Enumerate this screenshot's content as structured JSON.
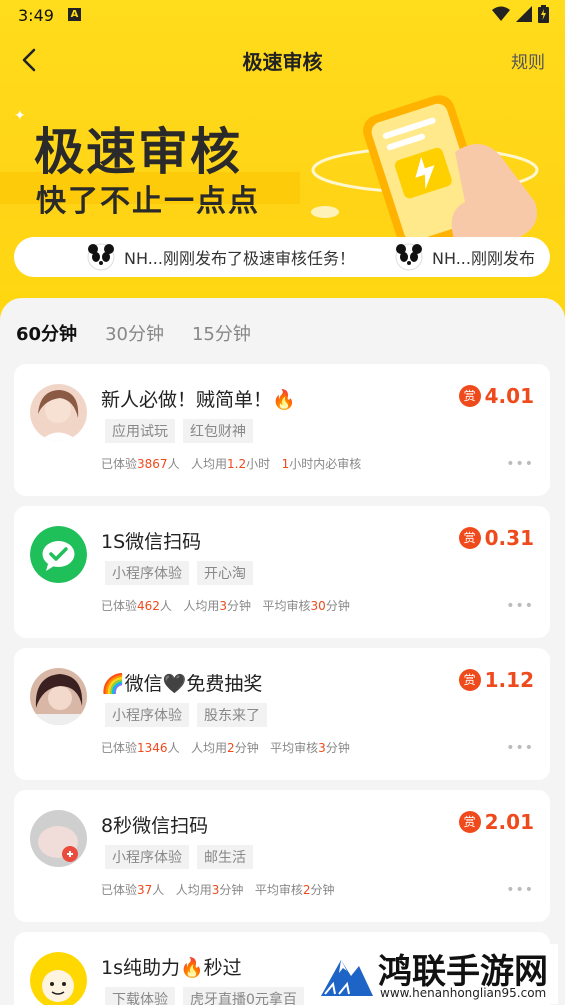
{
  "status_bar": {
    "time": "3:49",
    "a_icon": "A"
  },
  "nav": {
    "title": "极速审核",
    "rules": "规则"
  },
  "banner": {
    "title": "极速审核",
    "subtitle": "快了不止一点点"
  },
  "ticker": {
    "items": [
      "NH...刚刚发布了极速审核任务！",
      "NH...刚刚发布"
    ]
  },
  "tabs": [
    {
      "label": "60分钟",
      "active": true
    },
    {
      "label": "30分钟"
    },
    {
      "label": "15分钟"
    }
  ],
  "tasks": [
    {
      "title": "新人必做！贼简单！🔥",
      "tags": [
        "应用试玩",
        "红包财神"
      ],
      "reward": "4.01",
      "stats": {
        "p1": "已体验",
        "n1": "3867",
        "s1": "人",
        "p2": "人均用",
        "n2": "1.2",
        "s2": "小时",
        "p3": "",
        "n3": "1",
        "s3": "小时内必审核"
      }
    },
    {
      "title": "1S微信扫码",
      "tags": [
        "小程序体验",
        "开心淘"
      ],
      "reward": "0.31",
      "stats": {
        "p1": "已体验",
        "n1": "462",
        "s1": "人",
        "p2": "人均用",
        "n2": "3",
        "s2": "分钟",
        "p3": "平均审核",
        "n3": "30",
        "s3": "分钟"
      }
    },
    {
      "title": "🌈微信🖤免费抽奖",
      "tags": [
        "小程序体验",
        "股东来了"
      ],
      "reward": "1.12",
      "stats": {
        "p1": "已体验",
        "n1": "1346",
        "s1": "人",
        "p2": "人均用",
        "n2": "2",
        "s2": "分钟",
        "p3": "平均审核",
        "n3": "3",
        "s3": "分钟"
      }
    },
    {
      "title": "8秒微信扫码",
      "tags": [
        "小程序体验",
        "邮生活"
      ],
      "reward": "2.01",
      "stats": {
        "p1": "已体验",
        "n1": "37",
        "s1": "人",
        "p2": "人均用",
        "n2": "3",
        "s2": "分钟",
        "p3": "平均审核",
        "n3": "2",
        "s3": "分钟"
      }
    },
    {
      "title": "1s纯助力🔥秒过",
      "tags": [
        "下载体验",
        "虎牙直播0元拿百"
      ],
      "reward": ""
    }
  ],
  "reward_badge": "赏",
  "more_dots": "•••",
  "watermark": {
    "name": "鸿联手游网",
    "url": "www.henanhonglian95.com"
  },
  "colors": {
    "brand_yellow": "#ffd417",
    "reward_red": "#ef4a1c",
    "wechat_green": "#1fbf5a"
  }
}
